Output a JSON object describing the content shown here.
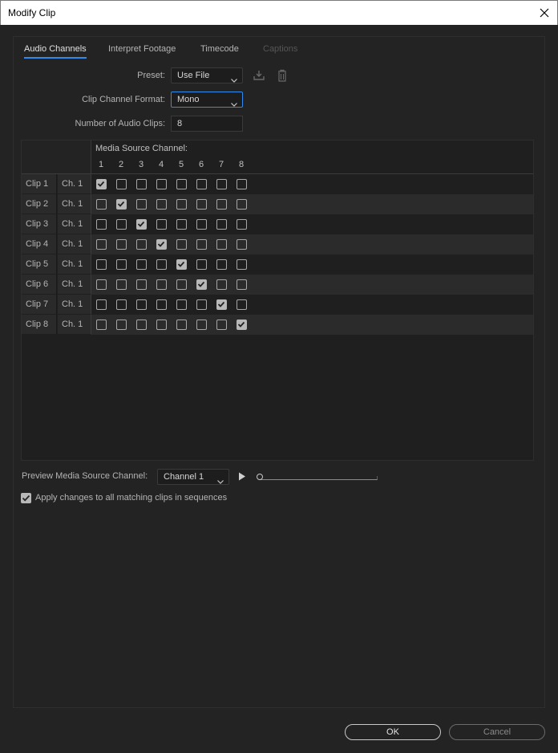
{
  "window": {
    "title": "Modify Clip"
  },
  "tabs": [
    {
      "label": "Audio Channels",
      "state": "active"
    },
    {
      "label": "Interpret Footage",
      "state": "normal"
    },
    {
      "label": "Timecode",
      "state": "normal"
    },
    {
      "label": "Captions",
      "state": "disabled"
    }
  ],
  "preset": {
    "label": "Preset:",
    "value": "Use File"
  },
  "clip_channel_format": {
    "label": "Clip Channel Format:",
    "value": "Mono"
  },
  "num_audio_clips": {
    "label": "Number of Audio Clips:",
    "value": "8"
  },
  "grid": {
    "header": "Media Source Channel:",
    "columns": [
      "1",
      "2",
      "3",
      "4",
      "5",
      "6",
      "7",
      "8"
    ],
    "rows": [
      {
        "clip": "Clip 1",
        "channel": "Ch. 1",
        "checked": 1
      },
      {
        "clip": "Clip 2",
        "channel": "Ch. 1",
        "checked": 2
      },
      {
        "clip": "Clip 3",
        "channel": "Ch. 1",
        "checked": 3
      },
      {
        "clip": "Clip 4",
        "channel": "Ch. 1",
        "checked": 4
      },
      {
        "clip": "Clip 5",
        "channel": "Ch. 1",
        "checked": 5
      },
      {
        "clip": "Clip 6",
        "channel": "Ch. 1",
        "checked": 6
      },
      {
        "clip": "Clip 7",
        "channel": "Ch. 1",
        "checked": 7
      },
      {
        "clip": "Clip 8",
        "channel": "Ch. 1",
        "checked": 8
      }
    ]
  },
  "preview": {
    "label": "Preview Media Source Channel:",
    "value": "Channel 1",
    "position": 0
  },
  "apply_all": {
    "label": "Apply changes to all matching clips in sequences",
    "checked": true
  },
  "buttons": {
    "ok": "OK",
    "cancel": "Cancel"
  },
  "colors": {
    "accent": "#2d8ceb",
    "background": "#232323"
  },
  "icons": [
    "close-icon",
    "chevron-down-icon",
    "save-preset-icon",
    "trash-icon",
    "play-icon",
    "checkmark-icon"
  ]
}
